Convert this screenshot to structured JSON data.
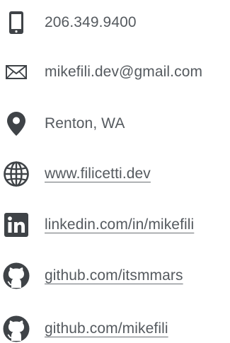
{
  "icon_color": "#3f4347",
  "text_color": "#555a5f",
  "contacts": {
    "phone": {
      "icon": "phone-icon",
      "text": "206.349.9400"
    },
    "email": {
      "icon": "envelope-icon",
      "text": "mikefili.dev@gmail.com"
    },
    "location": {
      "icon": "map-pin-icon",
      "text": "Renton, WA"
    },
    "website": {
      "icon": "globe-icon",
      "text": "www.filicetti.dev"
    },
    "linkedin": {
      "icon": "linkedin-icon",
      "text": "linkedin.com/in/mikefili"
    },
    "github_1": {
      "icon": "github-icon",
      "text": "github.com/itsmmars"
    },
    "github_2": {
      "icon": "github-icon",
      "text": "github.com/mikefili"
    }
  }
}
